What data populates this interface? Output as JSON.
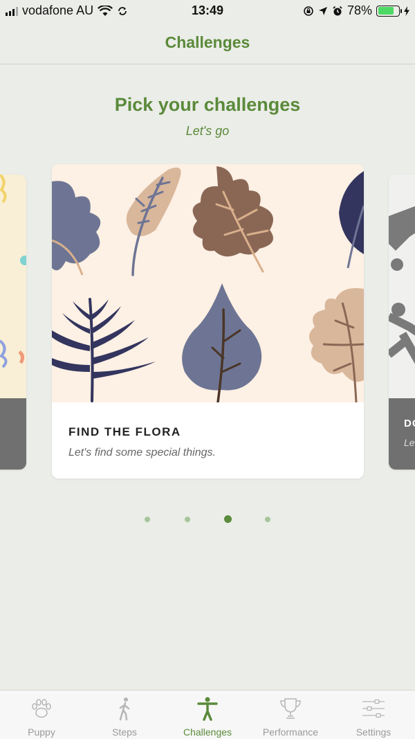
{
  "status_bar": {
    "carrier": "vodafone AU",
    "time": "13:49",
    "battery_percent": "78%",
    "battery_level": 0.78
  },
  "nav": {
    "title": "Challenges"
  },
  "heading": {
    "title": "Pick your challenges",
    "subtitle": "Let's go"
  },
  "card": {
    "title": "FIND THE FLORA",
    "subtitle": "Let's find some special things."
  },
  "peek_card_right": {
    "title": "DO",
    "subtitle": "Le"
  },
  "pager": {
    "count": 4,
    "active_index": 2
  },
  "tabs": [
    {
      "label": "Puppy",
      "icon": "paw-icon"
    },
    {
      "label": "Steps",
      "icon": "walking-person-icon"
    },
    {
      "label": "Challenges",
      "icon": "person-arms-out-icon"
    },
    {
      "label": "Performance",
      "icon": "trophy-icon"
    },
    {
      "label": "Settings",
      "icon": "sliders-icon"
    }
  ],
  "colors": {
    "accent": "#5a8a3a",
    "background": "#ebede8",
    "card_art_bg": "#fdf0e4"
  }
}
